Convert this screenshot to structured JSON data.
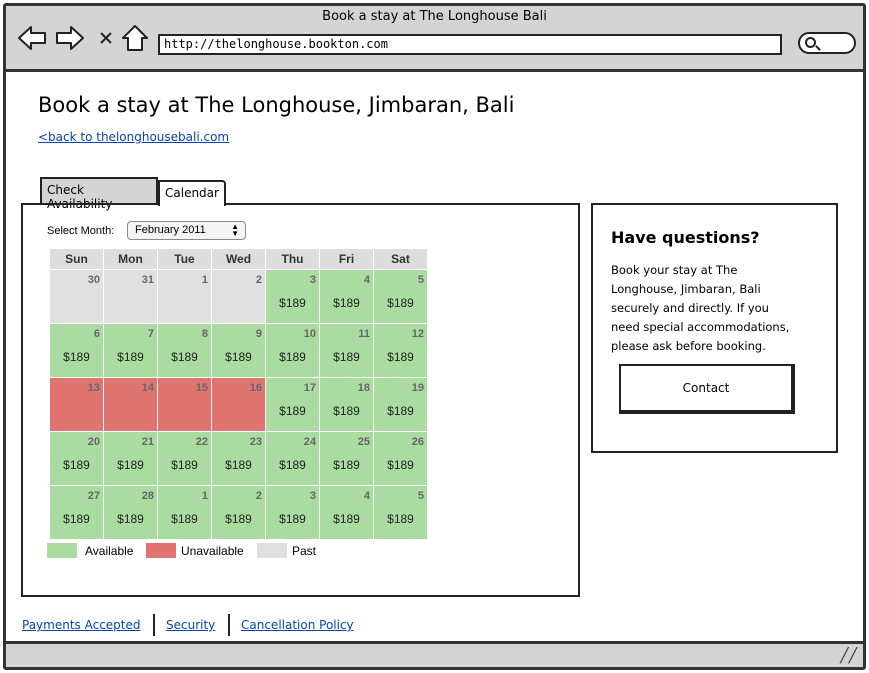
{
  "window": {
    "title": "Book a stay at The Longhouse Bali"
  },
  "browser": {
    "url": "http://thelonghouse.bookton.com"
  },
  "page": {
    "title": "Book a stay at The Longhouse, Jimbaran, Bali",
    "back_link": "<back to thelonghousebali.com"
  },
  "tabs": [
    {
      "label": "Check Availability",
      "active": false
    },
    {
      "label": "Calendar",
      "active": true
    }
  ],
  "calendar": {
    "month_label": "Select Month:",
    "selected_month": "February 2011",
    "weekdays": [
      "Sun",
      "Mon",
      "Tue",
      "Wed",
      "Thu",
      "Fri",
      "Sat"
    ],
    "weeks": [
      [
        {
          "day": "30",
          "price": "",
          "status": "past"
        },
        {
          "day": "31",
          "price": "",
          "status": "past"
        },
        {
          "day": "1",
          "price": "",
          "status": "past"
        },
        {
          "day": "2",
          "price": "",
          "status": "past"
        },
        {
          "day": "3",
          "price": "$189",
          "status": "available"
        },
        {
          "day": "4",
          "price": "$189",
          "status": "available"
        },
        {
          "day": "5",
          "price": "$189",
          "status": "available"
        }
      ],
      [
        {
          "day": "6",
          "price": "$189",
          "status": "available"
        },
        {
          "day": "7",
          "price": "$189",
          "status": "available"
        },
        {
          "day": "8",
          "price": "$189",
          "status": "available"
        },
        {
          "day": "9",
          "price": "$189",
          "status": "available"
        },
        {
          "day": "10",
          "price": "$189",
          "status": "available"
        },
        {
          "day": "11",
          "price": "$189",
          "status": "available"
        },
        {
          "day": "12",
          "price": "$189",
          "status": "available"
        }
      ],
      [
        {
          "day": "13",
          "price": "",
          "status": "unavailable"
        },
        {
          "day": "14",
          "price": "",
          "status": "unavailable"
        },
        {
          "day": "15",
          "price": "",
          "status": "unavailable"
        },
        {
          "day": "16",
          "price": "",
          "status": "unavailable"
        },
        {
          "day": "17",
          "price": "$189",
          "status": "available"
        },
        {
          "day": "18",
          "price": "$189",
          "status": "available"
        },
        {
          "day": "19",
          "price": "$189",
          "status": "available"
        }
      ],
      [
        {
          "day": "20",
          "price": "$189",
          "status": "available"
        },
        {
          "day": "21",
          "price": "$189",
          "status": "available"
        },
        {
          "day": "22",
          "price": "$189",
          "status": "available"
        },
        {
          "day": "23",
          "price": "$189",
          "status": "available"
        },
        {
          "day": "24",
          "price": "$189",
          "status": "available"
        },
        {
          "day": "25",
          "price": "$189",
          "status": "available"
        },
        {
          "day": "26",
          "price": "$189",
          "status": "available"
        }
      ],
      [
        {
          "day": "27",
          "price": "$189",
          "status": "available"
        },
        {
          "day": "28",
          "price": "$189",
          "status": "available"
        },
        {
          "day": "1",
          "price": "$189",
          "status": "available"
        },
        {
          "day": "2",
          "price": "$189",
          "status": "available"
        },
        {
          "day": "3",
          "price": "$189",
          "status": "available"
        },
        {
          "day": "4",
          "price": "$189",
          "status": "available"
        },
        {
          "day": "5",
          "price": "$189",
          "status": "available"
        }
      ]
    ],
    "legend": [
      {
        "label": "Available",
        "color": "#aadba0"
      },
      {
        "label": "Unavailable",
        "color": "#e07470"
      },
      {
        "label": "Past",
        "color": "#e0e0e0"
      }
    ]
  },
  "sidebar": {
    "title": "Have questions?",
    "text": "Book your stay at The Longhouse, Jimbaran, Bali securely and directly. If you need special accommodations, please ask before booking.",
    "contact_label": "Contact"
  },
  "footer": {
    "links": [
      "Payments Accepted",
      "Security",
      "Cancellation Policy"
    ]
  },
  "icons": {
    "back": "arrow-left-icon",
    "forward": "arrow-right-icon",
    "stop": "close-icon",
    "home": "home-icon",
    "search": "search-icon",
    "resize": "resize-grip-icon"
  },
  "colors": {
    "available": "#aadba0",
    "unavailable": "#e07470",
    "past": "#e0e0e0",
    "link": "#0645ad"
  }
}
